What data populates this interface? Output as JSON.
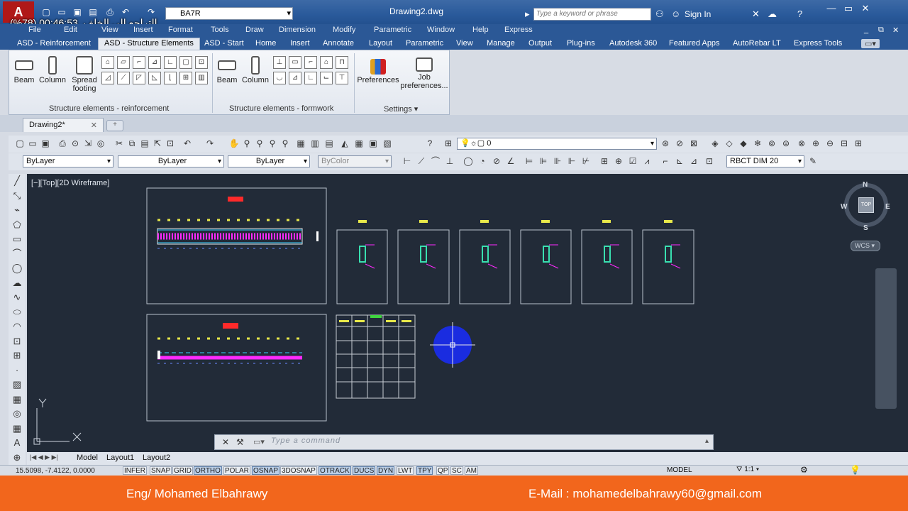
{
  "window": {
    "title": "Drawing2.dwg",
    "workspace": "BA7R"
  },
  "overlay": {
    "arabic_label": "التراجع إلى الخلف",
    "timer": "00:46:53 (78%)"
  },
  "search": {
    "placeholder": "Type a keyword or phrase"
  },
  "header": {
    "sign_in": "Sign In"
  },
  "menu": [
    "File",
    "Edit",
    "View",
    "Insert",
    "Format",
    "Tools",
    "Draw",
    "Dimension",
    "Modify",
    "Parametric",
    "Window",
    "Help",
    "Express"
  ],
  "ribbon_tabs": [
    "ASD - Reinforcement",
    "ASD - Structure Elements",
    "ASD - Start",
    "Home",
    "Insert",
    "Annotate",
    "Layout",
    "Parametric",
    "View",
    "Manage",
    "Output",
    "Plug-ins",
    "Autodesk 360",
    "Featured Apps",
    "AutoRebar LT",
    "Express Tools"
  ],
  "ribbon": {
    "reinforcement": {
      "beam": "Beam",
      "column": "Column",
      "spread1": "Spread",
      "spread2": "footing",
      "panel": "Structure elements - reinforcement"
    },
    "formwork": {
      "beam": "Beam",
      "column": "Column",
      "panel": "Structure elements - formwork"
    },
    "settings": {
      "preferences": "Preferences",
      "job1": "Job",
      "job2": "preferences...",
      "panel": "Settings"
    }
  },
  "doc_tab": {
    "name": "Drawing2*"
  },
  "toolbar": {
    "layer": "0",
    "color": "ByLayer",
    "linetype": "ByLayer",
    "lineweight": "ByLayer",
    "plotstyle": "ByColor",
    "dimstyle": "RBCT DIM 20"
  },
  "viewport": {
    "label": "[−][Top][2D Wireframe]"
  },
  "viewcube": {
    "n": "N",
    "s": "S",
    "e": "E",
    "w": "W",
    "top": "TOP",
    "wcs": "WCS"
  },
  "command": {
    "placeholder": "Type a command"
  },
  "layout_tabs": [
    "Model",
    "Layout1",
    "Layout2"
  ],
  "status": {
    "coords": "15.5098, -7.4122, 0.0000",
    "buttons": [
      "INFER",
      "SNAP",
      "GRID",
      "ORTHO",
      "POLAR",
      "OSNAP",
      "3DOSNAP",
      "OTRACK",
      "DUCS",
      "DYN",
      "LWT",
      "TPY",
      "QP",
      "SC",
      "AM"
    ],
    "on": [
      3,
      5,
      7,
      8,
      9,
      11
    ],
    "model": "MODEL",
    "scale": "1:1"
  },
  "footer": {
    "author": "Eng/ Mohamed Elbahrawy",
    "email": "E-Mail : mohamedelbahrawy60@gmail.com"
  },
  "colors": {
    "accent_orange": "#f2661c",
    "canvas": "#222b38",
    "magenta": "#ff2aff",
    "yellow": "#e8e84a",
    "blue_circle": "#1a2ce0",
    "red": "#ff2a2a"
  }
}
